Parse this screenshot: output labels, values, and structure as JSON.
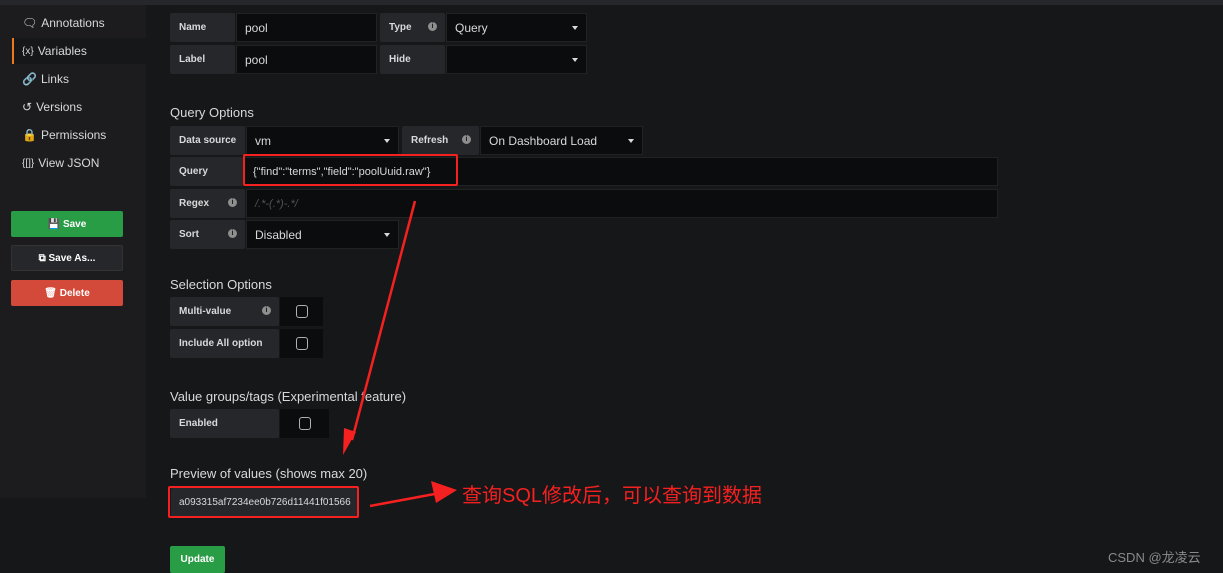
{
  "sidebar": {
    "items": [
      {
        "label": "Annotations",
        "icon": "comment-icon"
      },
      {
        "label": "Variables",
        "icon": "variable-icon",
        "active": true
      },
      {
        "label": "Links",
        "icon": "link-icon"
      },
      {
        "label": "Versions",
        "icon": "history-icon"
      },
      {
        "label": "Permissions",
        "icon": "lock-icon"
      },
      {
        "label": "View JSON",
        "icon": "json-icon"
      }
    ],
    "save": "Save",
    "save_as": "Save As...",
    "delete": "Delete"
  },
  "general": {
    "name_label": "Name",
    "name_value": "pool",
    "type_label": "Type",
    "type_value": "Query",
    "label_label": "Label",
    "label_value": "pool",
    "hide_label": "Hide",
    "hide_value": ""
  },
  "query_options": {
    "title": "Query Options",
    "datasource_label": "Data source",
    "datasource_value": "vm",
    "refresh_label": "Refresh",
    "refresh_value": "On Dashboard Load",
    "query_label": "Query",
    "query_value": "{\"find\":\"terms\",\"field\":\"poolUuid.raw\"}",
    "regex_label": "Regex",
    "regex_placeholder": "/.*-(.*)-.*/",
    "sort_label": "Sort",
    "sort_value": "Disabled"
  },
  "selection_options": {
    "title": "Selection Options",
    "multi_label": "Multi-value",
    "multi_checked": false,
    "include_all_label": "Include All option",
    "include_all_checked": false
  },
  "value_groups": {
    "title": "Value groups/tags (Experimental feature)",
    "enabled_label": "Enabled",
    "enabled_checked": false
  },
  "preview": {
    "title": "Preview of values (shows max 20)",
    "values": [
      "a093315af7234ee0b726d11441f01566"
    ]
  },
  "update": "Update",
  "annotation": {
    "text": "查询SQL修改后，可以查询到数据",
    "color": "#f52020"
  },
  "watermark": "CSDN @龙凌云",
  "colors": {
    "accent": "#eb7b18",
    "save": "#299c46",
    "delete": "#d44a3a",
    "background": "#161719"
  }
}
